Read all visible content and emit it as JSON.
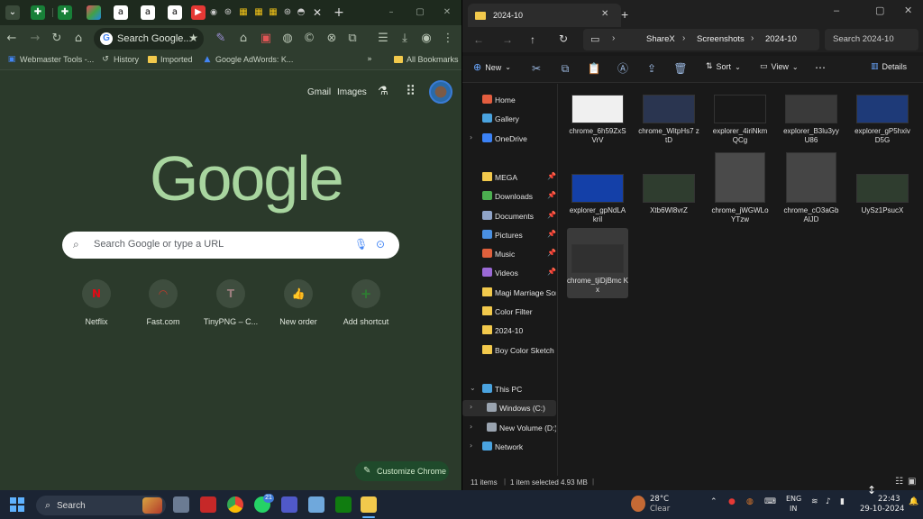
{
  "chrome": {
    "omnibox_text": "Search Google...",
    "bookmarks": [
      "Webmaster Tools -...",
      "History",
      "Imported",
      "Google AdWords: K...",
      "All Bookmarks"
    ],
    "ntp_links": [
      "Gmail",
      "Images"
    ],
    "logo": "Google",
    "search_placeholder": "Search Google or type a URL",
    "shortcuts": [
      {
        "label": "Netflix",
        "glyph": "N",
        "color": "#e50914"
      },
      {
        "label": "Fast.com",
        "glyph": "◠",
        "color": "#c0392b"
      },
      {
        "label": "TinyPNG – C...",
        "glyph": "T",
        "color": "#9a7d7d"
      },
      {
        "label": "New order",
        "glyph": "👍",
        "color": "#4a90d9"
      },
      {
        "label": "Add shortcut",
        "glyph": "+",
        "color": "#2e7d32"
      }
    ],
    "customize_label": "Customize Chrome",
    "extension_badge": "1"
  },
  "explorer": {
    "tab_title": "2024-10",
    "breadcrumb": [
      "ShareX",
      "Screenshots",
      "2024-10"
    ],
    "search_placeholder": "Search 2024-10",
    "commands": {
      "new": "New",
      "sort": "Sort",
      "view": "View",
      "details": "Details"
    },
    "nav": [
      {
        "label": "Home",
        "icon": "home-icon",
        "pin": false,
        "chev": false
      },
      {
        "label": "Gallery",
        "icon": "gallery-icon",
        "pin": false,
        "chev": false
      },
      {
        "label": "OneDrive",
        "icon": "cloud-icon",
        "pin": false,
        "chev": true
      },
      {
        "label": "MEGA",
        "icon": "folder-icon",
        "pin": true,
        "chev": false
      },
      {
        "label": "Downloads",
        "icon": "download-icon",
        "pin": true,
        "chev": false
      },
      {
        "label": "Documents",
        "icon": "document-icon",
        "pin": true,
        "chev": false
      },
      {
        "label": "Pictures",
        "icon": "picture-icon",
        "pin": true,
        "chev": false
      },
      {
        "label": "Music",
        "icon": "music-icon",
        "pin": true,
        "chev": false
      },
      {
        "label": "Videos",
        "icon": "video-icon",
        "pin": true,
        "chev": false
      },
      {
        "label": "Magi Marriage Son",
        "icon": "folder-icon",
        "pin": false,
        "chev": false
      },
      {
        "label": "Color Filter",
        "icon": "folder-icon",
        "pin": false,
        "chev": false
      },
      {
        "label": "2024-10",
        "icon": "folder-icon",
        "pin": false,
        "chev": false
      },
      {
        "label": "Boy Color Sketch",
        "icon": "folder-icon",
        "pin": false,
        "chev": false
      },
      {
        "label": "This PC",
        "icon": "pc-icon",
        "pin": false,
        "chev": true
      },
      {
        "label": "Windows (C:)",
        "icon": "drive-icon",
        "pin": false,
        "chev": true
      },
      {
        "label": "New Volume (D:)",
        "icon": "drive-icon",
        "pin": false,
        "chev": true
      },
      {
        "label": "Network",
        "icon": "network-icon",
        "pin": false,
        "chev": true
      }
    ],
    "files": [
      {
        "name": "chrome_6h59ZxS VrV",
        "bg": "#f0f0f0"
      },
      {
        "name": "chrome_WitpHs7 ztD",
        "bg": "#2a3550"
      },
      {
        "name": "explorer_4iriNkm QCg",
        "bg": "#191919"
      },
      {
        "name": "explorer_B3lu3yy U86",
        "bg": "#3a3a3a"
      },
      {
        "name": "explorer_gP5hxiv D5G",
        "bg": "#1e3a78"
      },
      {
        "name": "explorer_gpNdLA kril",
        "bg": "#1440a8"
      },
      {
        "name": "Xtb6Wl8vrZ",
        "bg": "#2f3d2f"
      },
      {
        "name": "chrome_jWGWLo YTzw",
        "bg": "#4a4a4a"
      },
      {
        "name": "chrome_cO3aGb AlJD",
        "bg": "#454545"
      },
      {
        "name": "UySz1PsucX",
        "bg": "#2f3d2f"
      },
      {
        "name": "chrome_tjiDjBmc Kx",
        "bg": "#303030"
      }
    ],
    "status": {
      "items": "11 items",
      "selected": "1 item selected",
      "size": "4.93 MB"
    }
  },
  "taskbar": {
    "search": "Search",
    "weather_temp": "28°C",
    "weather_desc": "Clear",
    "lang1": "ENG",
    "lang2": "IN",
    "time": "22:43",
    "date": "29-10-2024",
    "teams_badge": "21"
  }
}
